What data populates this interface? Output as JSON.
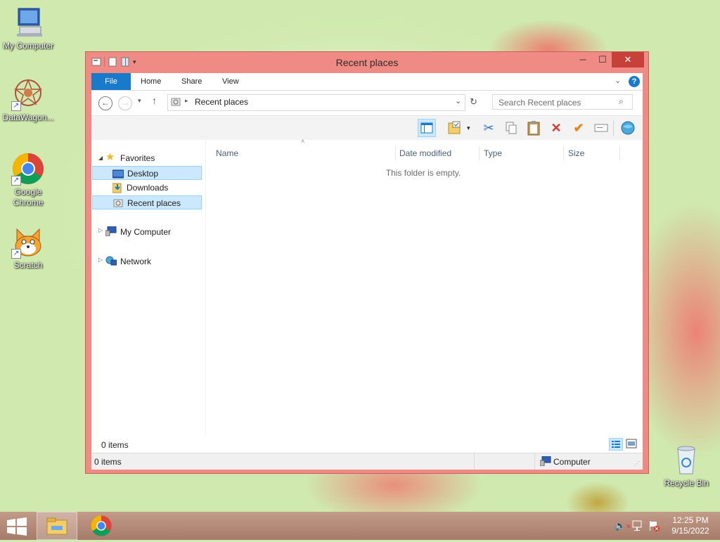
{
  "desktop": {
    "icons": [
      {
        "label": "My Computer"
      },
      {
        "label": "DataWagon..."
      },
      {
        "label": "Google Chrome"
      },
      {
        "label": "Scratch"
      },
      {
        "label": "Recycle Bin"
      }
    ]
  },
  "window": {
    "title": "Recent places",
    "controls": {
      "minimize": "─",
      "maximize": "☐",
      "close": "✕"
    },
    "ribbon_tabs": [
      "File",
      "Home",
      "Share",
      "View"
    ],
    "address": {
      "path": "Recent places"
    },
    "search": {
      "placeholder": "Search Recent places"
    },
    "nav": {
      "favorites": "Favorites",
      "items": [
        "Desktop",
        "Downloads",
        "Recent places"
      ],
      "my_computer": "My Computer",
      "network": "Network"
    },
    "columns": [
      "Name",
      "Date modified",
      "Type",
      "Size"
    ],
    "empty_message": "This folder is empty.",
    "item_count": "0 items",
    "status": {
      "left": "0 items",
      "right": "Computer"
    }
  },
  "taskbar": {
    "time": "12:25 PM",
    "date": "9/15/2022"
  },
  "colors": {
    "accent": "#1979ca",
    "window_frame": "#f08a84",
    "close_button": "#c7403a",
    "selection": "#cce8ff"
  }
}
